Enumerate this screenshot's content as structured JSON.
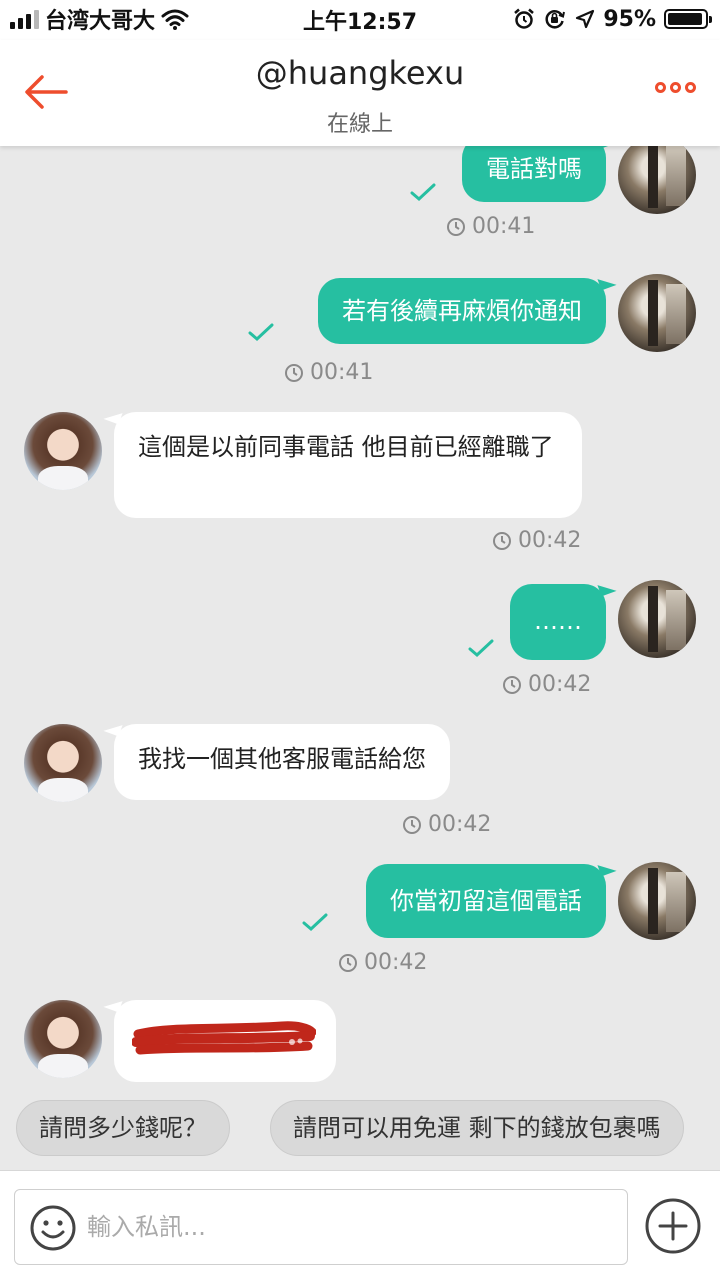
{
  "status_bar": {
    "carrier": "台湾大哥大",
    "time": "上午12:57",
    "battery": "95%",
    "battery_level": 0.95,
    "icons": [
      "signal-icon",
      "wifi-icon",
      "alarm-icon",
      "orientation-lock-icon",
      "location-icon",
      "battery-icon"
    ]
  },
  "header": {
    "title": "@huangkexu",
    "subtitle": "在線上",
    "icons": [
      "back-arrow-icon",
      "more-icon"
    ],
    "accent_color": "#ee4d2d"
  },
  "messages": [
    {
      "sender": "me",
      "text": "電話對嗎",
      "time": "00:41",
      "read": true
    },
    {
      "sender": "me",
      "text": "若有後續再麻煩你通知",
      "time": "00:41",
      "read": true
    },
    {
      "sender": "seller",
      "text": "這個是以前同事電話 他目前已經離職了",
      "time": "00:42"
    },
    {
      "sender": "me",
      "text": "……",
      "time": "00:42",
      "read": true
    },
    {
      "sender": "seller",
      "text": "我找一個其他客服電話給您",
      "time": "00:42"
    },
    {
      "sender": "me",
      "text": "你當初留這個電話",
      "time": "00:42",
      "read": true
    },
    {
      "sender": "seller",
      "text": "",
      "redacted": true
    }
  ],
  "quick_replies": [
    "請問多少錢呢？",
    "請問可以用免運 剩下的錢放包裹嗎"
  ],
  "input": {
    "placeholder": "輸入私訊...",
    "value": "",
    "icons": [
      "emoji-icon",
      "plus-icon"
    ]
  },
  "colors": {
    "my_bubble": "#26bfa1",
    "seller_bubble": "#ffffff",
    "background": "#e9e9e9",
    "redaction": "#c0271b"
  }
}
